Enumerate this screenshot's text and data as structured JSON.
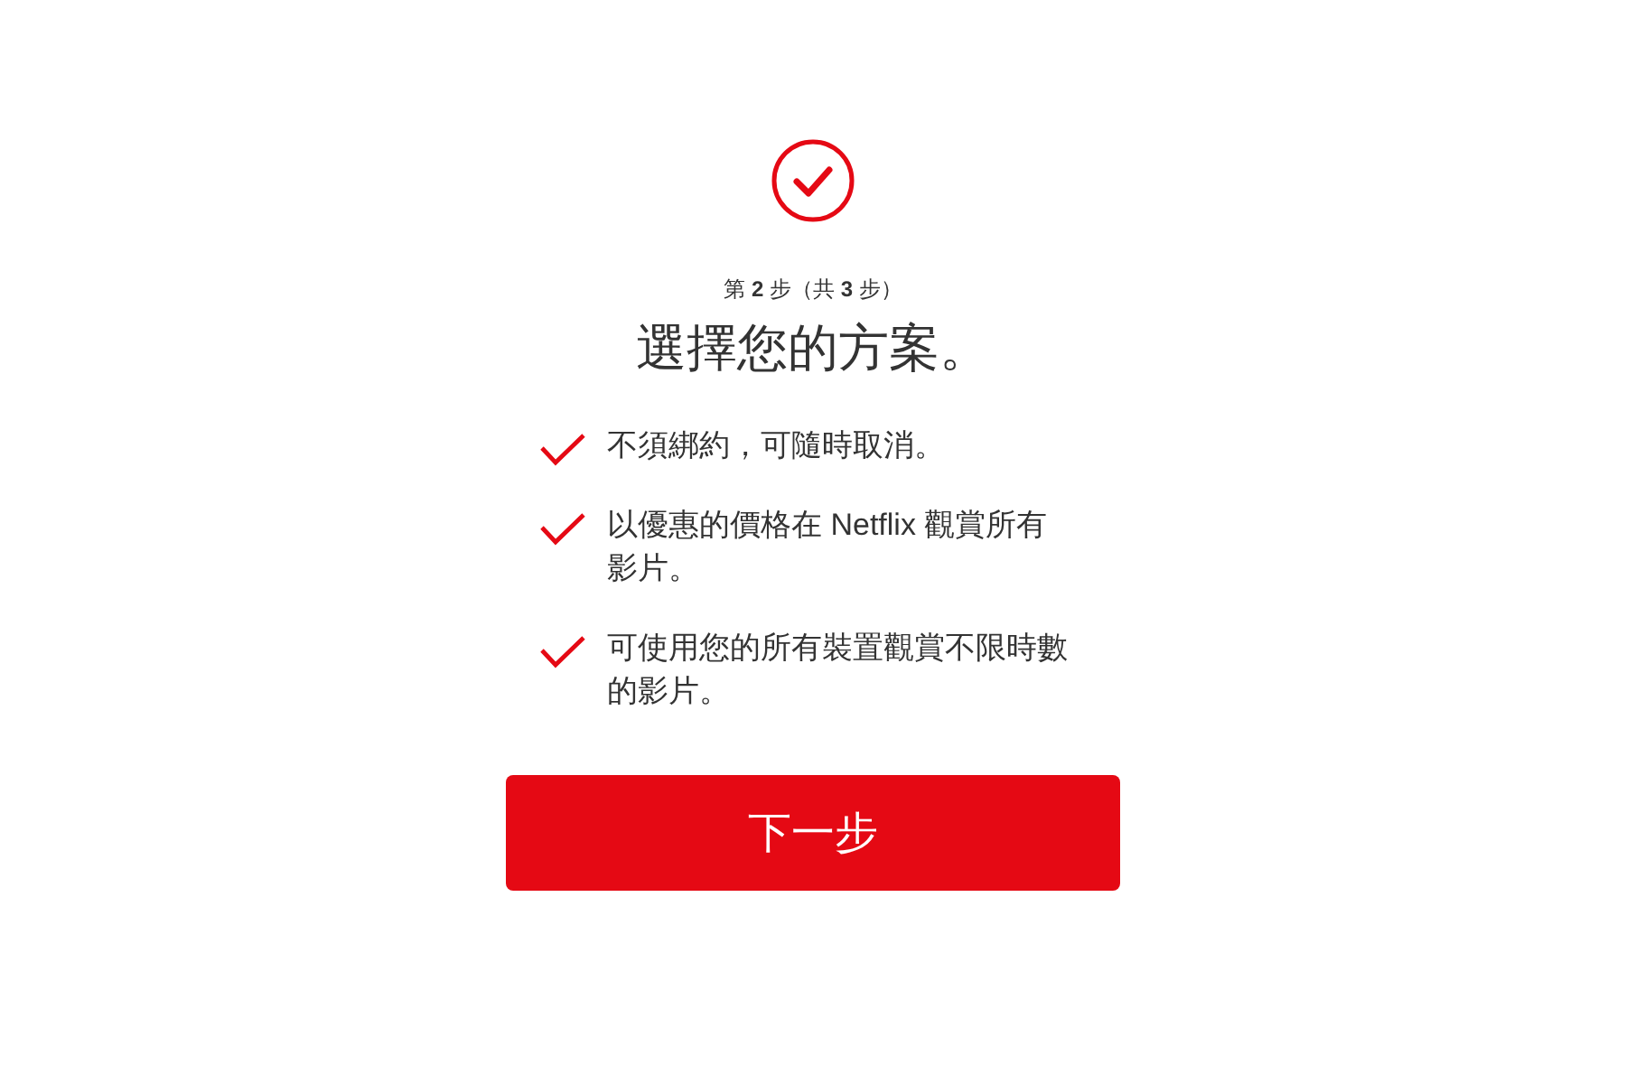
{
  "step_label": "第 **2** 步（共 **3** 步）",
  "title": "選擇您的方案。",
  "features": [
    {
      "text": "不須綁約，可隨時取消。"
    },
    {
      "text": "以優惠的價格在 Netflix 觀賞所有影片。"
    },
    {
      "text": "可使用您的所有裝置觀賞不限時數的影片。"
    }
  ],
  "next_button": "下一步"
}
